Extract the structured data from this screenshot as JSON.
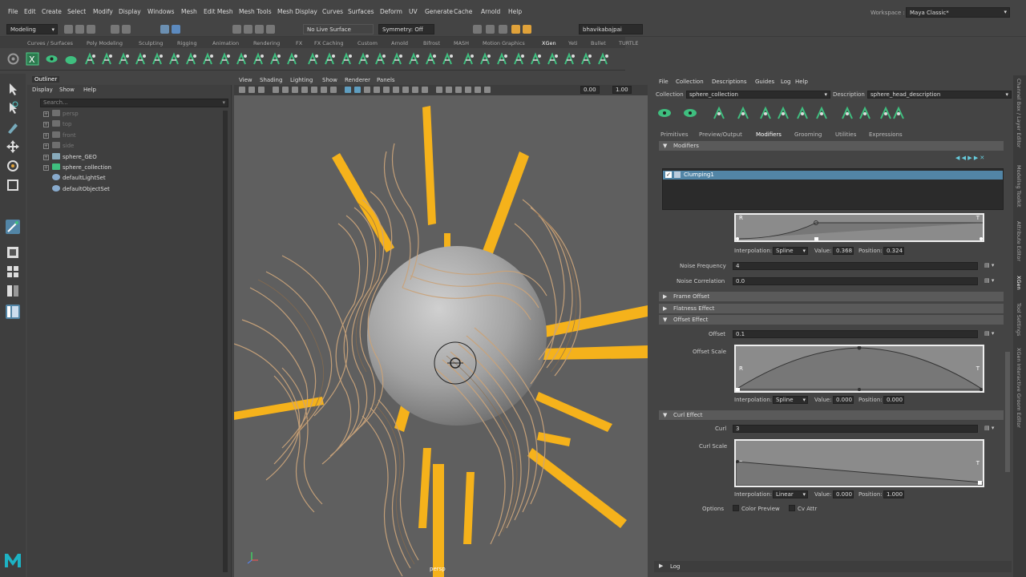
{
  "menubar": [
    "File",
    "Edit",
    "Create",
    "Select",
    "Modify",
    "Display",
    "Windows",
    "Mesh",
    "Edit Mesh",
    "Mesh Tools",
    "Mesh Display",
    "Curves",
    "Surfaces",
    "Deform",
    "UV",
    "Generate",
    "Cache",
    "Arnold",
    "Help"
  ],
  "workspace": {
    "label": "Workspace :",
    "value": "Maya Classic*"
  },
  "status": {
    "mode": "Modeling",
    "live_surface": "No Live Surface",
    "symmetry": "Symmetry: Off",
    "user": "bhavikabajpai"
  },
  "shelf_tabs": [
    "Curves / Surfaces",
    "Poly Modeling",
    "Sculpting",
    "Rigging",
    "Animation",
    "Rendering",
    "FX",
    "FX Caching",
    "Custom",
    "Arnold",
    "Bifrost",
    "MASH",
    "Motion Graphics",
    "XGen",
    "Yeti",
    "Bullet",
    "TURTLE"
  ],
  "shelf_active": "XGen",
  "outliner": {
    "title": "Outliner",
    "menu": [
      "Display",
      "Show",
      "Help"
    ],
    "search_placeholder": "Search...",
    "items": [
      {
        "label": "persp",
        "dim": true
      },
      {
        "label": "top",
        "dim": true
      },
      {
        "label": "front",
        "dim": true
      },
      {
        "label": "side",
        "dim": true
      },
      {
        "label": "sphere_GEO",
        "dim": false
      },
      {
        "label": "sphere_collection",
        "dim": false
      },
      {
        "label": "defaultLightSet",
        "dim": false
      },
      {
        "label": "defaultObjectSet",
        "dim": false
      }
    ]
  },
  "viewport": {
    "menu": [
      "View",
      "Shading",
      "Lighting",
      "Show",
      "Renderer",
      "Panels"
    ],
    "field1": "0.00",
    "field2": "1.00",
    "camera": "persp"
  },
  "xgen": {
    "menu": [
      "File",
      "Collection",
      "Descriptions",
      "Guides",
      "Log",
      "Help"
    ],
    "collection_label": "Collection",
    "collection_value": "sphere_collection",
    "description_label": "Description",
    "description_value": "sphere_head_description",
    "tabs": [
      "Primitives",
      "Preview/Output",
      "Modifiers",
      "Grooming",
      "Utilities",
      "Expressions"
    ],
    "active_tab": "Modifiers",
    "modifiers_header": "Modifiers",
    "modifier_item": "Clumping1",
    "ramp1": {
      "interp_label": "Interpolation:",
      "interp": "Spline",
      "value_label": "Value:",
      "value": "0.368",
      "pos_label": "Position:",
      "pos": "0.324",
      "left": "R",
      "right": "T"
    },
    "noise_frequency": {
      "label": "Noise Frequency",
      "value": "4"
    },
    "noise_correlation": {
      "label": "Noise Correlation",
      "value": "0.0"
    },
    "sections": {
      "frame_offset": "Frame Offset",
      "flatness": "Flatness Effect",
      "offset_effect": "Offset Effect",
      "curl_effect": "Curl Effect"
    },
    "offset": {
      "label": "Offset",
      "value": "0.1"
    },
    "offset_scale": {
      "label": "Offset Scale",
      "interp_label": "Interpolation:",
      "interp": "Spline",
      "value_label": "Value:",
      "value": "0.000",
      "pos_label": "Position:",
      "pos": "0.000",
      "left": "R",
      "right": "T"
    },
    "curl": {
      "label": "Curl",
      "value": "3"
    },
    "curl_scale": {
      "label": "Curl Scale",
      "interp_label": "Interpolation:",
      "interp": "Linear",
      "value_label": "Value:",
      "value": "0.000",
      "pos_label": "Position:",
      "pos": "1.000",
      "left": "R",
      "right": "T"
    },
    "options": {
      "label": "Options",
      "color_preview": "Color Preview",
      "cv_attr": "Cv Attr"
    },
    "log": "Log"
  },
  "right_strip": [
    "Channel Box / Layer Editor",
    "Modeling Toolkit",
    "Attribute Editor",
    "XGen",
    "Tool Settings",
    "XGen Interactive Groom Editor"
  ],
  "colors": {
    "accent_green": "#3fbf7f",
    "selection_blue": "#5285a6",
    "hair": "#c9a37a",
    "stripe": "#f5b21b"
  }
}
